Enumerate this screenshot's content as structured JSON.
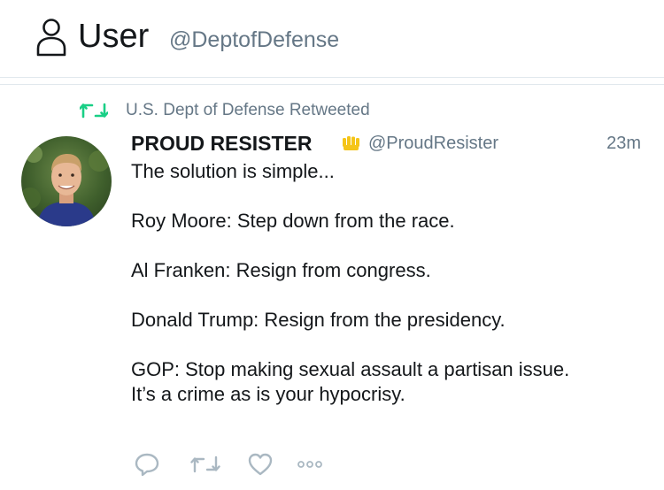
{
  "header": {
    "title": "User",
    "handle": "@DeptofDefense",
    "icon": "user-icon"
  },
  "tweet": {
    "retweet_context": "U.S. Dept of Defense Retweeted",
    "author_name": "PROUD RESISTER",
    "author_badge_icon": "raised-fist-icon",
    "screen_name": "@ProudResister",
    "time": "23m",
    "lines": {
      "l1": "The solution is simple...",
      "l2": "Roy Moore: Step down from the race.",
      "l3": "Al Franken: Resign from congress.",
      "l4": "Donald Trump: Resign from the presidency.",
      "l5": "GOP: Stop making sexual assault a partisan issue.",
      "l6": "It’s a crime as is your hypocrisy."
    },
    "actions": [
      "reply-icon",
      "retweet-icon",
      "like-icon",
      "more-icon"
    ]
  },
  "colors": {
    "retweet_green": "#19cf86",
    "muted_gray": "#657786",
    "text": "#14171a",
    "icon_gray": "#aab8c2"
  }
}
